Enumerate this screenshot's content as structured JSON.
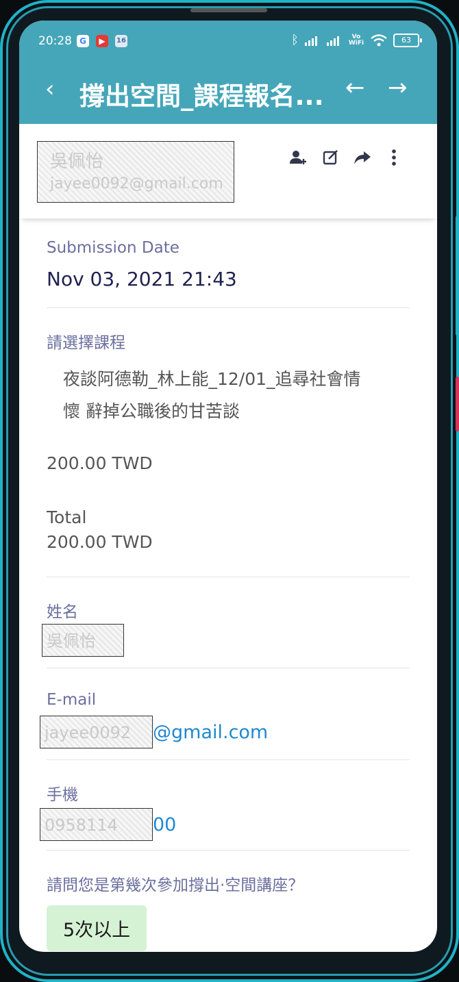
{
  "status_bar": {
    "time": "20:28",
    "icons": [
      "google-icon",
      "youtube-icon",
      "calendar-16-icon"
    ],
    "calendar_day": "16",
    "right_icons": [
      "bluetooth-icon",
      "signal-icon",
      "signal-icon",
      "vowifi-icon",
      "wifi-icon",
      "battery-icon"
    ],
    "vowifi": "Vo WiFi",
    "battery": "63"
  },
  "app_bar": {
    "back_icon": "‹",
    "title": "撐出空間_課程報名...",
    "prev_icon": "←",
    "next_icon": "→"
  },
  "header": {
    "submitter_name_redacted": "吳佩怡",
    "submitter_email_redacted": "jayee0092@gmail.com",
    "actions": [
      "add-person-icon",
      "edit-icon",
      "share-icon",
      "more-vert-icon"
    ]
  },
  "submission": {
    "date_label": "Submission Date",
    "date_value": "Nov 03, 2021 21:43"
  },
  "course": {
    "label": "請選擇課程",
    "line1": "夜談阿德勒_林上能_12/01_追尋社會情",
    "line2": "懷 辭掉公職後的甘苦談",
    "price": "200.00 TWD",
    "total_label": "Total",
    "total_value": "200.00 TWD"
  },
  "name": {
    "label": "姓名",
    "value_redacted": "吳佩怡"
  },
  "email": {
    "label": "E-mail",
    "value_redacted": "jayee0092",
    "value_visible": "@gmail.com"
  },
  "phone": {
    "label": "手機",
    "value_redacted": "0958114",
    "value_visible": "00"
  },
  "attendance": {
    "question": "請問您是第幾次參加撐出·空間講座？",
    "answer": "5次以上"
  },
  "colors": {
    "appbar": "#45a6b9",
    "label": "#6b6f9e",
    "link": "#1f87d1",
    "badge": "#d5f2d4"
  }
}
